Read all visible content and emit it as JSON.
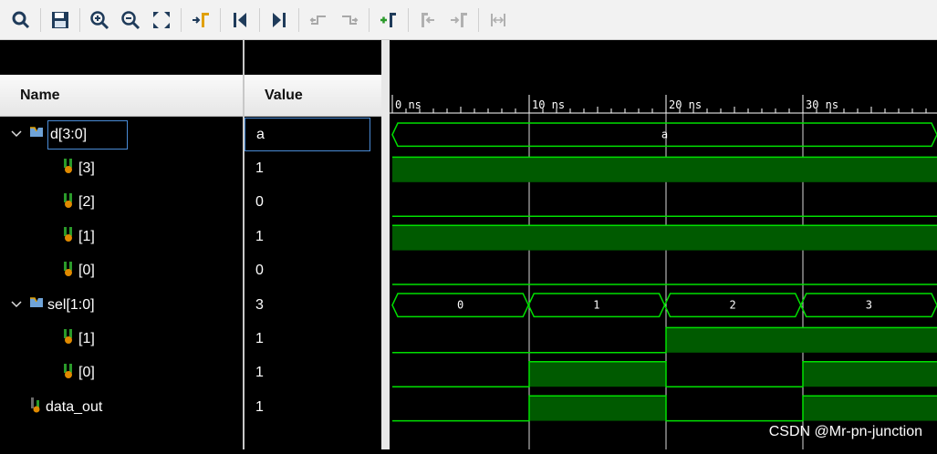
{
  "toolbar": {
    "buttons": [
      "search",
      "save",
      "zoom-in",
      "zoom-out",
      "zoom-fit",
      "go-to-cursor",
      "go-to-start",
      "go-to-end",
      "previous-transition",
      "next-transition",
      "add-marker",
      "previous-marker",
      "next-marker",
      "swap-cursors"
    ]
  },
  "headers": {
    "name": "Name",
    "value": "Value"
  },
  "signals": [
    {
      "name": "d[3:0]",
      "value": "a",
      "kind": "bus",
      "level": 0,
      "expanded": true,
      "selected": true
    },
    {
      "name": "[3]",
      "value": "1",
      "kind": "bit",
      "level": 1
    },
    {
      "name": "[2]",
      "value": "0",
      "kind": "bit",
      "level": 1
    },
    {
      "name": "[1]",
      "value": "1",
      "kind": "bit",
      "level": 1
    },
    {
      "name": "[0]",
      "value": "0",
      "kind": "bit",
      "level": 1
    },
    {
      "name": "sel[1:0]",
      "value": "3",
      "kind": "bus",
      "level": 0,
      "expanded": true
    },
    {
      "name": "[1]",
      "value": "1",
      "kind": "bit",
      "level": 1
    },
    {
      "name": "[0]",
      "value": "1",
      "kind": "bit",
      "level": 1
    },
    {
      "name": "data_out",
      "value": "1",
      "kind": "out",
      "level": 0
    }
  ],
  "ruler": {
    "labels": [
      "0 ns",
      "10 ns",
      "20 ns",
      "30 ns"
    ]
  },
  "waves": {
    "d_bus": [
      "a"
    ],
    "d3": [
      1,
      1,
      1,
      1
    ],
    "d2": [
      0,
      0,
      0,
      0
    ],
    "d1": [
      1,
      1,
      1,
      1
    ],
    "d0": [
      0,
      0,
      0,
      0
    ],
    "sel_bus": [
      "0",
      "1",
      "2",
      "3"
    ],
    "sel1": [
      0,
      0,
      1,
      1
    ],
    "sel0": [
      0,
      1,
      0,
      1
    ],
    "data_out": [
      0,
      1,
      0,
      1
    ]
  },
  "colors": {
    "wave": "#00e000",
    "fill": "#005a00",
    "cursor": "#ffffff",
    "selection": "#4a8bd6"
  },
  "watermark": "CSDN @Mr-pn-junction"
}
